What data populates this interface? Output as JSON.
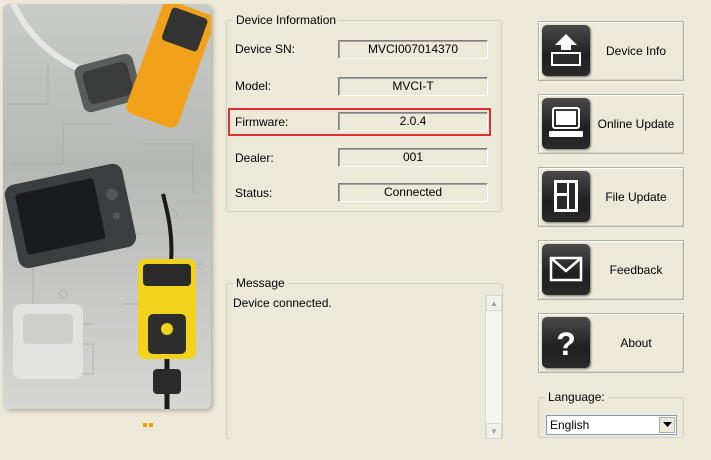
{
  "device_info": {
    "title": "Device Information",
    "fields": [
      {
        "label": "Device SN:",
        "value": "MVCI007014370"
      },
      {
        "label": "Model:",
        "value": "MVCI-T"
      },
      {
        "label": "Firmware:",
        "value": "2.0.4"
      },
      {
        "label": "Dealer:",
        "value": "001"
      },
      {
        "label": "Status:",
        "value": "Connected"
      }
    ]
  },
  "message": {
    "title": "Message",
    "text": "Device connected."
  },
  "buttons": [
    {
      "label": "Device Info",
      "icon": "device-info-icon"
    },
    {
      "label": "Online Update",
      "icon": "online-update-icon"
    },
    {
      "label": "File Update",
      "icon": "file-update-icon"
    },
    {
      "label": "Feedback",
      "icon": "feedback-icon"
    },
    {
      "label": "About",
      "icon": "about-icon"
    }
  ],
  "language": {
    "title": "Language:",
    "selected": "English"
  },
  "colors": {
    "highlight": "#e23030",
    "accent_dots": "#f39c12"
  }
}
